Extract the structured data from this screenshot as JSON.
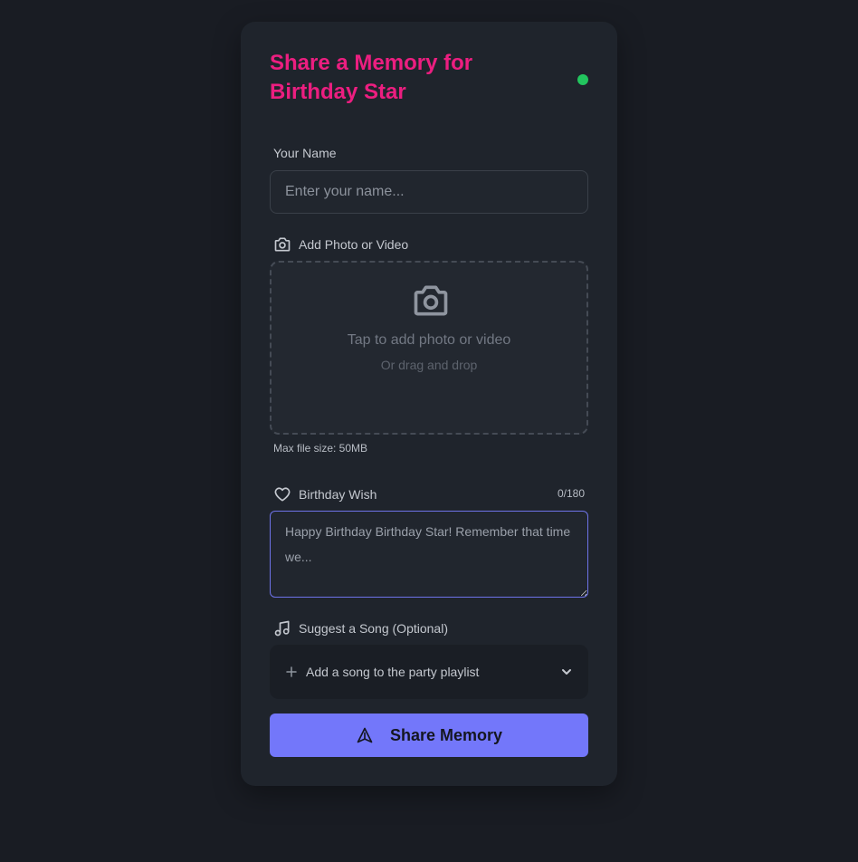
{
  "form": {
    "title": "Share a Memory for Birthday Star",
    "name_label": "Your Name",
    "name_placeholder": "Enter your name...",
    "name_value": "",
    "media_label": "Add Photo or Video",
    "dropzone_main": "Tap to add photo or video",
    "dropzone_sub": "Or drag and drop",
    "max_size": "Max file size: 50MB",
    "wish_label": "Birthday Wish",
    "wish_counter": "0/180",
    "wish_placeholder": "Happy Birthday Birthday Star! Remember that time we...",
    "song_label": "Suggest a Song (Optional)",
    "song_placeholder": "Add a song to the party playlist",
    "submit_label": "Share Memory"
  },
  "icons": {
    "status": "status-dot",
    "media": "camera-icon",
    "wish": "heart-icon",
    "song": "music-note-icon",
    "song_add": "plus-icon",
    "song_expand": "chevron-down-icon",
    "submit": "send-icon"
  },
  "colors": {
    "accent": "#ec1e80",
    "status": "#22c55e",
    "primary": "#7377fa",
    "background": "#191c23",
    "card": "#1f242c"
  }
}
